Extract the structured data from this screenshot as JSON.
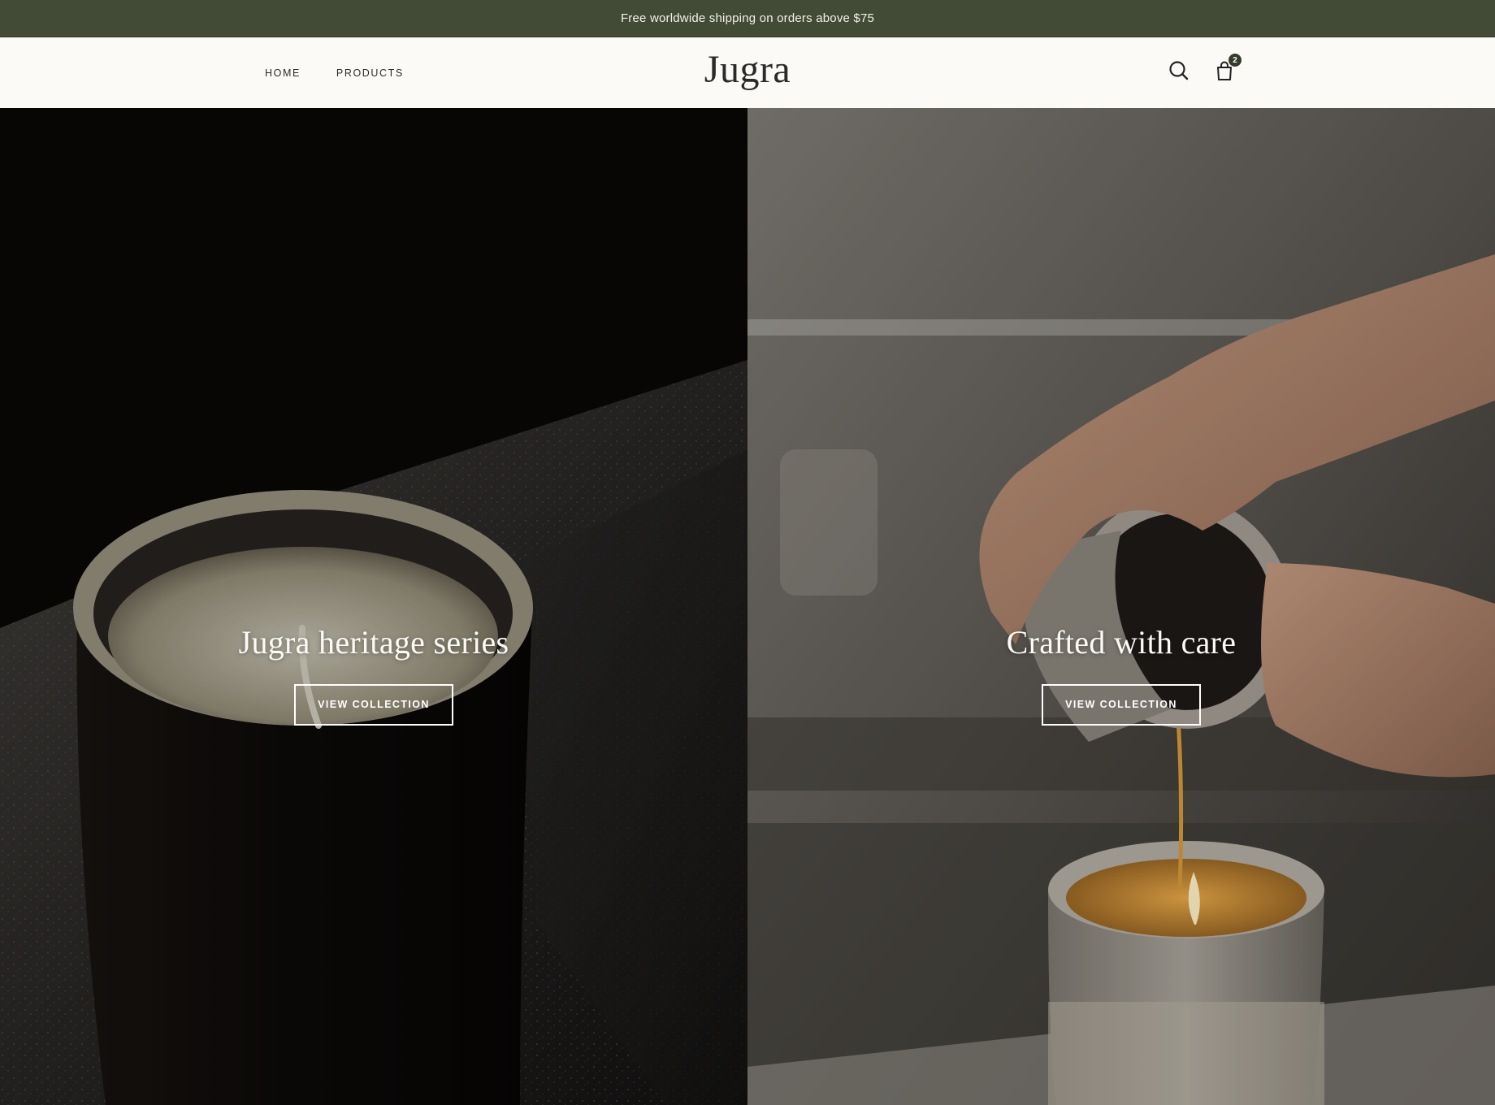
{
  "announcement": {
    "text": "Free worldwide shipping on orders above $75"
  },
  "header": {
    "nav": [
      {
        "label": "HOME"
      },
      {
        "label": "PRODUCTS"
      }
    ],
    "logo": "Jugra",
    "cart_count": "2"
  },
  "hero": {
    "panels": [
      {
        "title": "Jugra heritage series",
        "cta": "VIEW COLLECTION"
      },
      {
        "title": "Crafted with care",
        "cta": "VIEW COLLECTION"
      }
    ]
  },
  "colors": {
    "announcement_bg": "#414b35",
    "header_bg": "#fbfaf7",
    "text_dark": "#2b2b2b",
    "hero_text": "#ffffff"
  },
  "icons": [
    "search-icon",
    "cart-icon"
  ]
}
